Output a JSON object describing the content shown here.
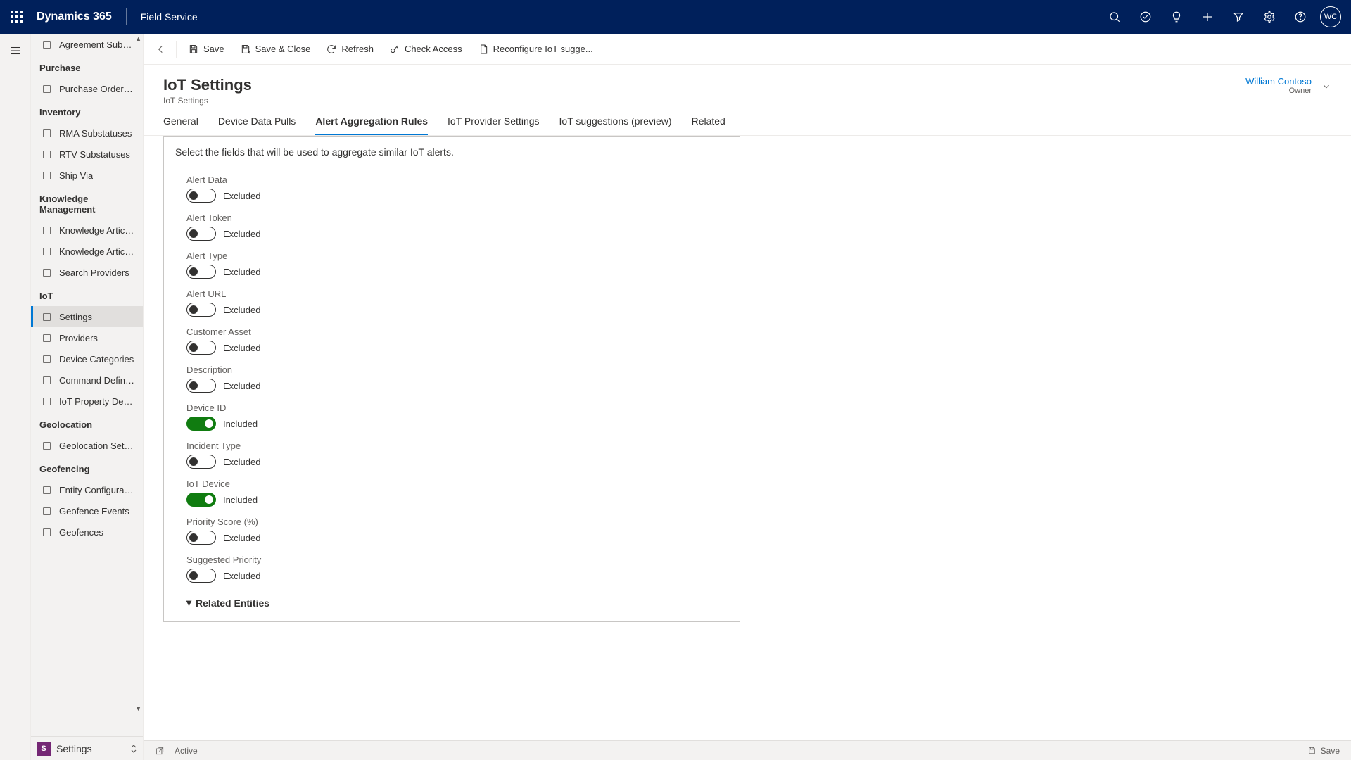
{
  "top": {
    "brand": "Dynamics 365",
    "module": "Field Service",
    "avatar": "WC"
  },
  "sidebar": {
    "first_item": "Agreement Subst...",
    "groups": [
      {
        "title": "Purchase",
        "items": [
          "Purchase Order S..."
        ]
      },
      {
        "title": "Inventory",
        "items": [
          "RMA Substatuses",
          "RTV Substatuses",
          "Ship Via"
        ]
      },
      {
        "title": "Knowledge Management",
        "items": [
          "Knowledge Articles",
          "Knowledge Article...",
          "Search Providers"
        ]
      },
      {
        "title": "IoT",
        "items": [
          "Settings",
          "Providers",
          "Device Categories",
          "Command Definiti...",
          "IoT Property Defin..."
        ]
      },
      {
        "title": "Geolocation",
        "items": [
          "Geolocation Setti..."
        ]
      },
      {
        "title": "Geofencing",
        "items": [
          "Entity Configurati...",
          "Geofence Events",
          "Geofences"
        ]
      }
    ],
    "active": "Settings",
    "area": {
      "badge": "S",
      "label": "Settings"
    }
  },
  "commands": {
    "save": "Save",
    "save_close": "Save & Close",
    "refresh": "Refresh",
    "check_access": "Check Access",
    "reconfigure": "Reconfigure IoT sugge..."
  },
  "page": {
    "title": "IoT Settings",
    "subtitle": "IoT Settings",
    "owner_name": "William Contoso",
    "owner_role": "Owner"
  },
  "tabs": [
    "General",
    "Device Data Pulls",
    "Alert Aggregation Rules",
    "IoT Provider Settings",
    "IoT suggestions (preview)",
    "Related"
  ],
  "active_tab": "Alert Aggregation Rules",
  "panel_hint": "Select the fields that will be used to aggregate similar IoT alerts.",
  "state_labels": {
    "on": "Included",
    "off": "Excluded"
  },
  "fields": [
    {
      "label": "Alert Data",
      "on": false
    },
    {
      "label": "Alert Token",
      "on": false
    },
    {
      "label": "Alert Type",
      "on": false
    },
    {
      "label": "Alert URL",
      "on": false
    },
    {
      "label": "Customer Asset",
      "on": false
    },
    {
      "label": "Description",
      "on": false
    },
    {
      "label": "Device ID",
      "on": true
    },
    {
      "label": "Incident Type",
      "on": false
    },
    {
      "label": "IoT Device",
      "on": true
    },
    {
      "label": "Priority Score (%)",
      "on": false
    },
    {
      "label": "Suggested Priority",
      "on": false
    }
  ],
  "related_section": "Related Entities",
  "status": {
    "state": "Active",
    "save": "Save"
  }
}
